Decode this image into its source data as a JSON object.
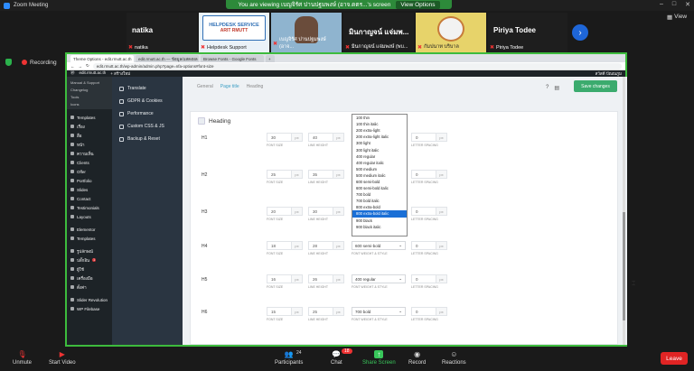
{
  "window": {
    "title": "Zoom Meeting"
  },
  "banner": {
    "text": "You are viewing เบญจิรัศ ปานปฐมพงษ์ (อาจ.ดตร...'s screen",
    "options": "View Options"
  },
  "gallery": {
    "tiles": [
      {
        "name": "natika",
        "footer": "natika"
      },
      {
        "name": "",
        "footer": "Helpdesk Support"
      },
      {
        "name": "",
        "footer": "เบญจิรัศ ปานปฐมพงษ์ (อาจ..."
      },
      {
        "name": "มินกาญจน์ แจ่มพ...",
        "footer": "มินกาญจน์ แจ่มพงษ์ (พบ..."
      },
      {
        "name": "",
        "footer": "กัมปนาท บริบาล"
      },
      {
        "name": "Piriya Todee",
        "footer": "Piriya Todee"
      }
    ],
    "view_label": "View",
    "poster_title": "HELPDESK SERVICE",
    "poster_sub": "ARIT RMUTT"
  },
  "recording": {
    "label": "Recording"
  },
  "browser": {
    "tabs": [
      "Theme Options - edit.rmutt.ac.th",
      "edit.rmutt.ac.th — ข้อมูล/แสดงผล",
      "Browse Fonts - Google Fonts",
      "+"
    ],
    "url": "edit.rmutt.ac.th/wp-admin/admin.php?page=nfa-options#font-size"
  },
  "wpadmin": {
    "site": "edit.rmutt.ac.th",
    "new": "+ สร้างใหม่",
    "user": "สวัสดี ปัณณภูม"
  },
  "wpsidebar": {
    "submenu": [
      "Manual & Support",
      "Changelog",
      "Tools",
      "Icons"
    ],
    "items": [
      {
        "label": "Templates"
      },
      {
        "label": "เรื่อง"
      },
      {
        "label": "สื่อ"
      },
      {
        "label": "หน้า"
      },
      {
        "label": "ความเห็น"
      },
      {
        "label": "Clients"
      },
      {
        "label": "Offer"
      },
      {
        "label": "Portfolio"
      },
      {
        "label": "Slides"
      },
      {
        "label": "Contact"
      },
      {
        "label": "Testimonials"
      },
      {
        "label": "Layouts"
      },
      {
        "label": "Elementor"
      },
      {
        "label": "Templates"
      },
      {
        "label": "รูปลักษณ์"
      },
      {
        "label": "ปลั๊กอิน",
        "badge": "1"
      },
      {
        "label": "ผู้ใช้"
      },
      {
        "label": "เครื่องมือ"
      },
      {
        "label": "ตั้งค่า"
      },
      {
        "label": "Slider Revolution"
      },
      {
        "label": "WP Filebase"
      }
    ]
  },
  "themenav": {
    "items": [
      "Translate",
      "GDPR & Cookies",
      "Performance",
      "Custom CSS & JS",
      "Backup & Reset"
    ]
  },
  "subtabs": [
    "General",
    "Page title",
    "Heading"
  ],
  "save_label": "Save changes",
  "panel": {
    "title": "Heading",
    "captions": {
      "font_size": "FONT SIZE",
      "line_height": "LINE HEIGHT",
      "font_weight": "FONT WEIGHT & STYLE",
      "letter_spacing": "LETTER SPACING"
    },
    "unit": "px",
    "rows": [
      {
        "label": "H1",
        "font_size": "30",
        "line_height": "40",
        "weight": "",
        "spacing": "0"
      },
      {
        "label": "H2",
        "font_size": "25",
        "line_height": "35",
        "weight": "",
        "spacing": "0"
      },
      {
        "label": "H3",
        "font_size": "20",
        "line_height": "30",
        "weight": "",
        "spacing": "0"
      },
      {
        "label": "H4",
        "font_size": "18",
        "line_height": "28",
        "weight": "600 semi-bold",
        "spacing": "0"
      },
      {
        "label": "H5",
        "font_size": "16",
        "line_height": "26",
        "weight": "400 regular",
        "spacing": "0"
      },
      {
        "label": "H6",
        "font_size": "15",
        "line_height": "25",
        "weight": "700 bold",
        "spacing": "0"
      }
    ]
  },
  "dropdown": {
    "options": [
      "100 thin",
      "100 thin italic",
      "200 extra-light",
      "200 extra-light italic",
      "300 light",
      "300 light italic",
      "400 regular",
      "400 regular italic",
      "500 medium",
      "500 medium italic",
      "600 semi-bold",
      "600 semi-bold italic",
      "700 bold",
      "700 bold italic",
      "800 extra-bold",
      "800 extra-bold italic",
      "900 black",
      "900 black italic"
    ],
    "selected_index": 15
  },
  "toolbar": {
    "items": [
      {
        "label": "Unmute"
      },
      {
        "label": "Start Video"
      },
      {
        "label": "Participants",
        "count": "24"
      },
      {
        "label": "Chat",
        "count": "18"
      },
      {
        "label": "Share Screen"
      },
      {
        "label": "Record"
      },
      {
        "label": "Reactions"
      }
    ],
    "leave": "Leave"
  },
  "colors": {
    "share_border": "#3dbb3d",
    "save": "#3bab6e",
    "leave": "#e02424",
    "banner": "#2d8a3a"
  }
}
